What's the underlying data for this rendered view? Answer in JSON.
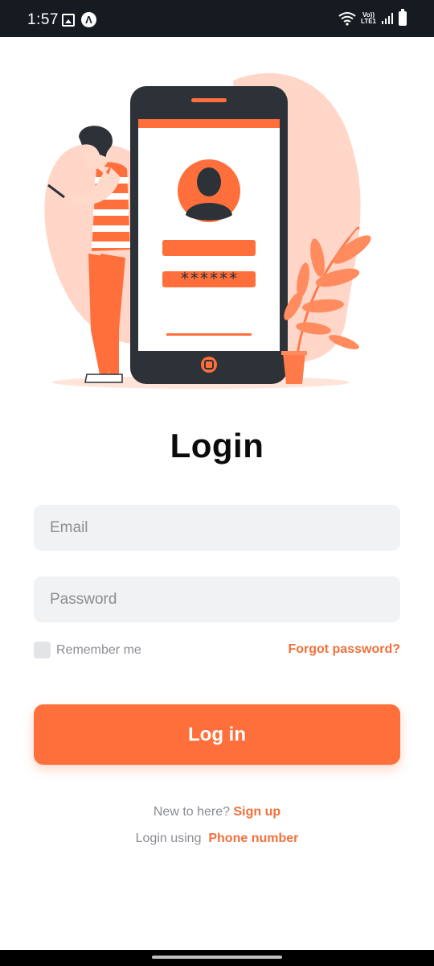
{
  "status_bar": {
    "time": "1:57",
    "network_label_top": "Vo))",
    "network_label_bottom": "LTE1",
    "icons": [
      "gallery-icon",
      "nav-app-icon",
      "wifi-icon",
      "volte-icon",
      "signal-icon",
      "battery-icon"
    ]
  },
  "login": {
    "title": "Login",
    "email_placeholder": "Email",
    "password_placeholder": "Password",
    "remember_label": "Remember me",
    "forgot_label": "Forgot password?",
    "login_button": "Log in",
    "new_here_text": "New to here?",
    "signup_link": "Sign up",
    "login_using_text": "Login using",
    "phone_link": "Phone number"
  },
  "colors": {
    "accent": "#ff6f3c",
    "link": "#f2703a",
    "input_bg": "#f1f2f4",
    "blob": "#ffd6c8",
    "phone_body": "#2d3238",
    "status_bar_bg": "#161a21"
  }
}
